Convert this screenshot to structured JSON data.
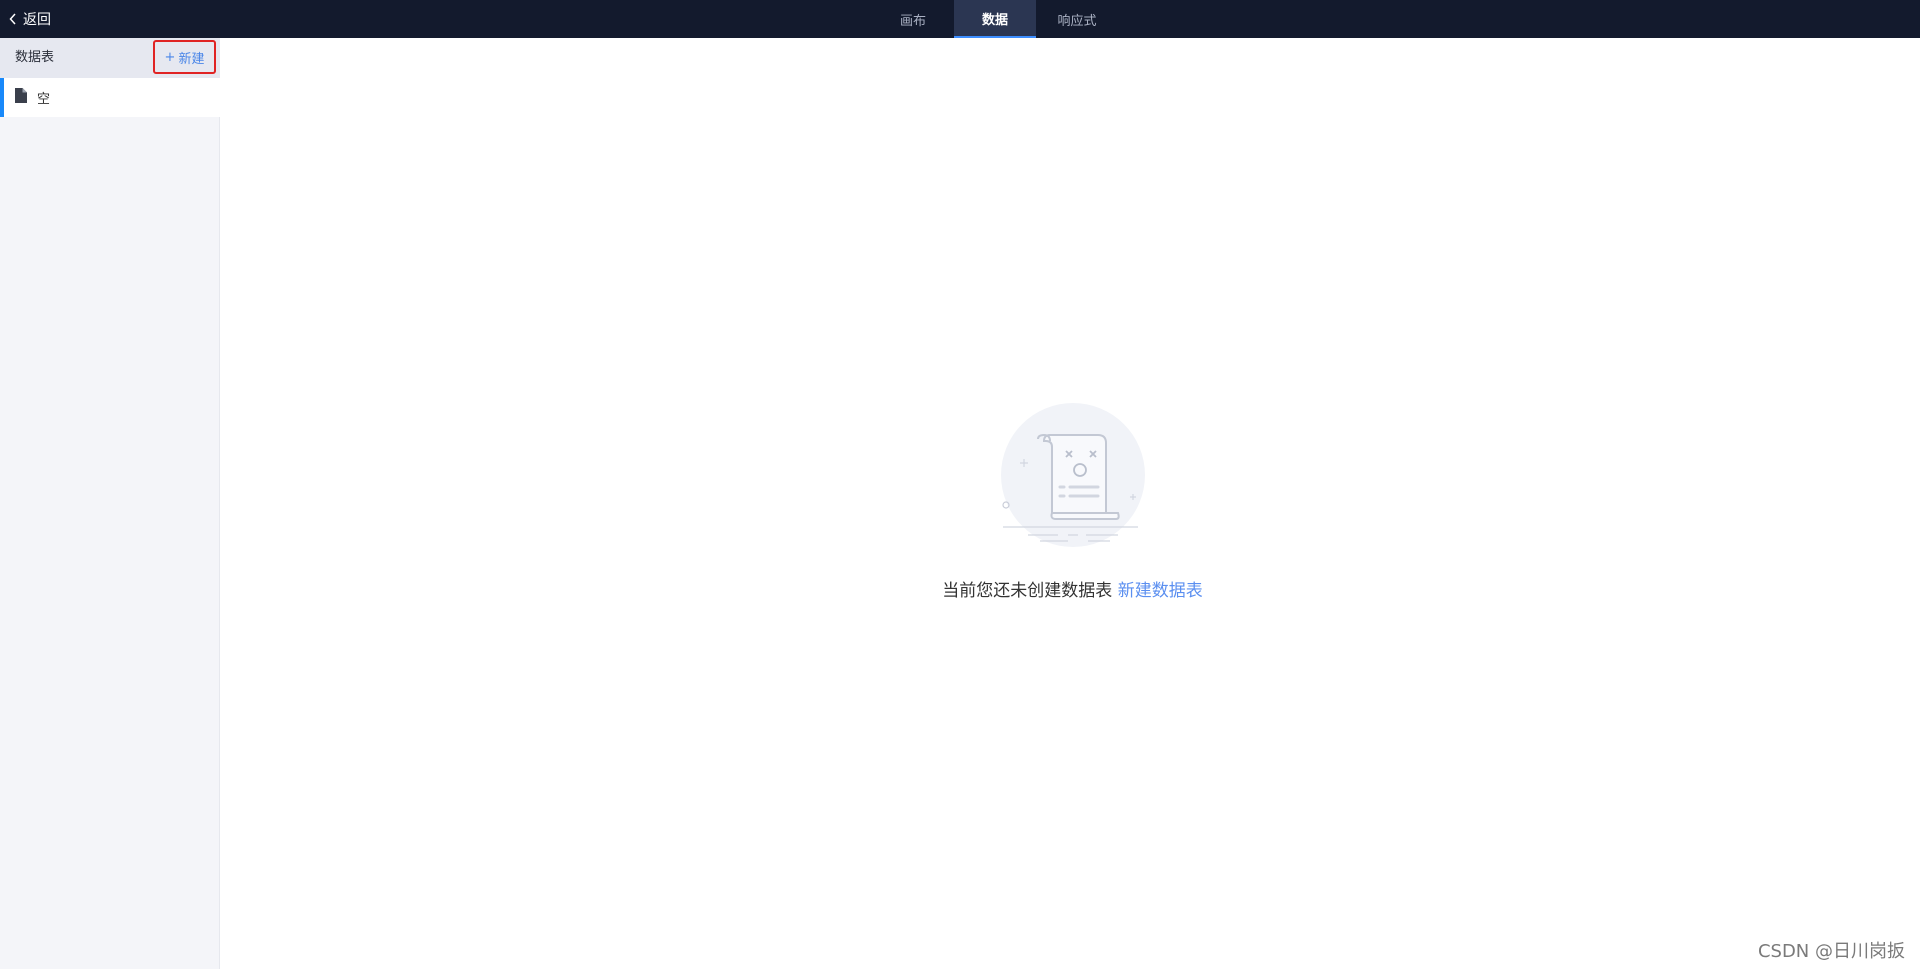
{
  "topbar": {
    "back_label": "返回",
    "tabs": [
      {
        "label": "画布"
      },
      {
        "label": "数据"
      },
      {
        "label": "响应式"
      }
    ]
  },
  "sidebar": {
    "title": "数据表",
    "new_button": {
      "icon": "+",
      "label": "新建"
    },
    "items": [
      {
        "icon": "file-icon",
        "label": "空"
      }
    ]
  },
  "main": {
    "empty_state": {
      "icon": "empty-document-icon",
      "text": "当前您还未创建数据表",
      "link": "新建数据表"
    }
  },
  "watermark": "CSDN @日川岗扳",
  "colors": {
    "topbar_bg": "#131a2d",
    "active_tab_bg": "#2b3652",
    "accent": "#1989fa",
    "link": "#5b8ff0",
    "highlight_border": "#e02424"
  }
}
